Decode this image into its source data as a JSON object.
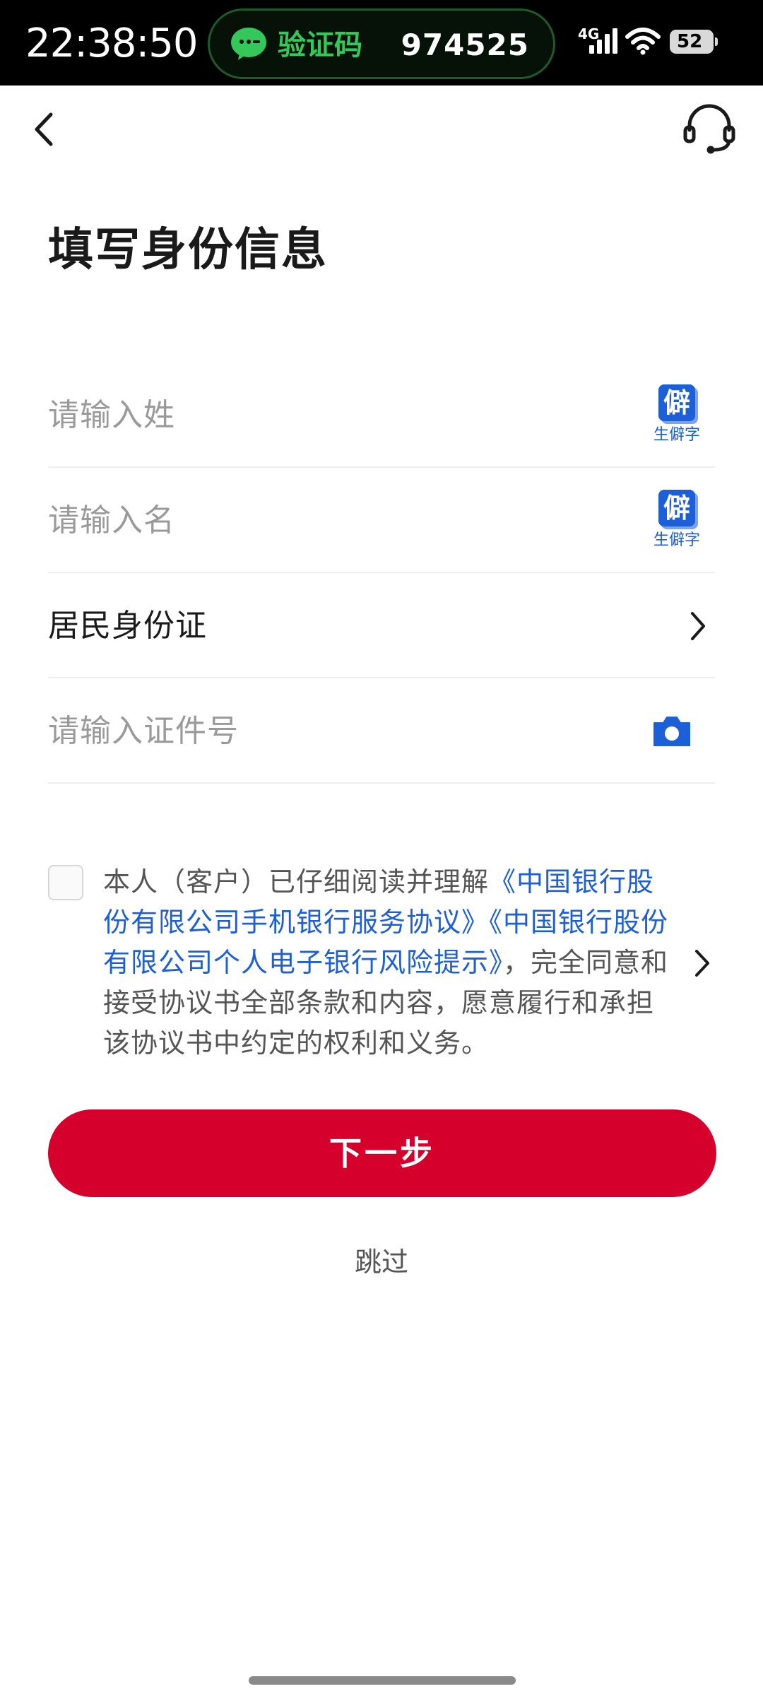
{
  "status_bar": {
    "time": "22:38:50",
    "notification": {
      "app_icon": "wechat-icon",
      "title": "验证码",
      "code": "974525"
    },
    "network": "4G",
    "battery": "52"
  },
  "header": {
    "back_icon": "chevron-left-icon",
    "service_icon": "headset-icon"
  },
  "page": {
    "title": "填写身份信息"
  },
  "form": {
    "surname": {
      "placeholder": "请输入姓",
      "rare_char_icon": "僻",
      "rare_char_label": "生僻字"
    },
    "given_name": {
      "placeholder": "请输入名",
      "rare_char_icon": "僻",
      "rare_char_label": "生僻字"
    },
    "id_type": {
      "value": "居民身份证"
    },
    "id_number": {
      "placeholder": "请输入证件号",
      "icon": "camera-icon"
    }
  },
  "agreement": {
    "prefix": "本人（客户）已仔细阅读并理解",
    "link1": "《中国银行股份有限公司手机银行服务协议》",
    "link2": "《中国银行股份有限公司个人电子银行风险提示》",
    "suffix": "，完全同意和接受协议书全部条款和内容，愿意履行和承担该协议书中约定的权利和义务。"
  },
  "actions": {
    "next_label": "下一步",
    "skip_label": "跳过"
  },
  "colors": {
    "primary_red": "#d6002d",
    "link_blue": "#1d5fd6"
  }
}
